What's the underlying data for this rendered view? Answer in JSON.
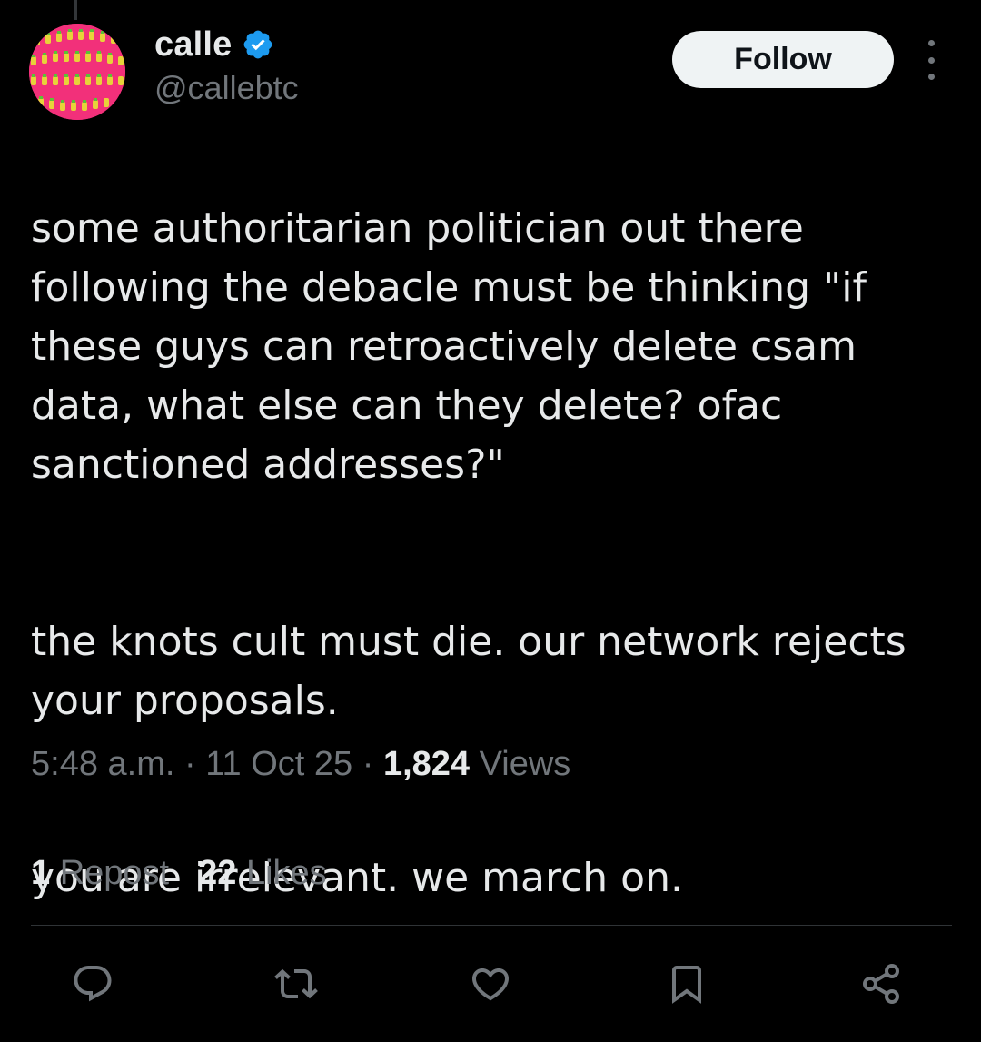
{
  "author": {
    "display_name": "calle",
    "handle": "@callebtc",
    "verified": true,
    "avatar_color": "#f2307a"
  },
  "follow_label": "Follow",
  "tweet": {
    "paragraphs": [
      "some authoritarian politician out there following the debacle must be thinking \"if these guys can retroactively delete csam data, what else can they delete? ofac sanctioned addresses?\"",
      "the knots cult must die. our network rejects your proposals.",
      "you are irrelevant. we march on."
    ]
  },
  "meta": {
    "time": "5:48 a.m.",
    "sep1": " · ",
    "date": "11 Oct 25",
    "sep2": " · ",
    "views_count": "1,824",
    "views_label": " Views"
  },
  "stats": {
    "reposts_count": "1",
    "reposts_label": " Repost",
    "likes_count": "22",
    "likes_label": " Likes"
  },
  "actions": [
    {
      "icon": "reply-icon"
    },
    {
      "icon": "repost-icon"
    },
    {
      "icon": "like-icon"
    },
    {
      "icon": "bookmark-icon"
    },
    {
      "icon": "share-icon"
    }
  ],
  "colors": {
    "background": "#000000",
    "primary_text": "#e7e9ea",
    "secondary_text": "#71767b",
    "verified_blue": "#1d9bf0",
    "divider": "#2f3336"
  }
}
